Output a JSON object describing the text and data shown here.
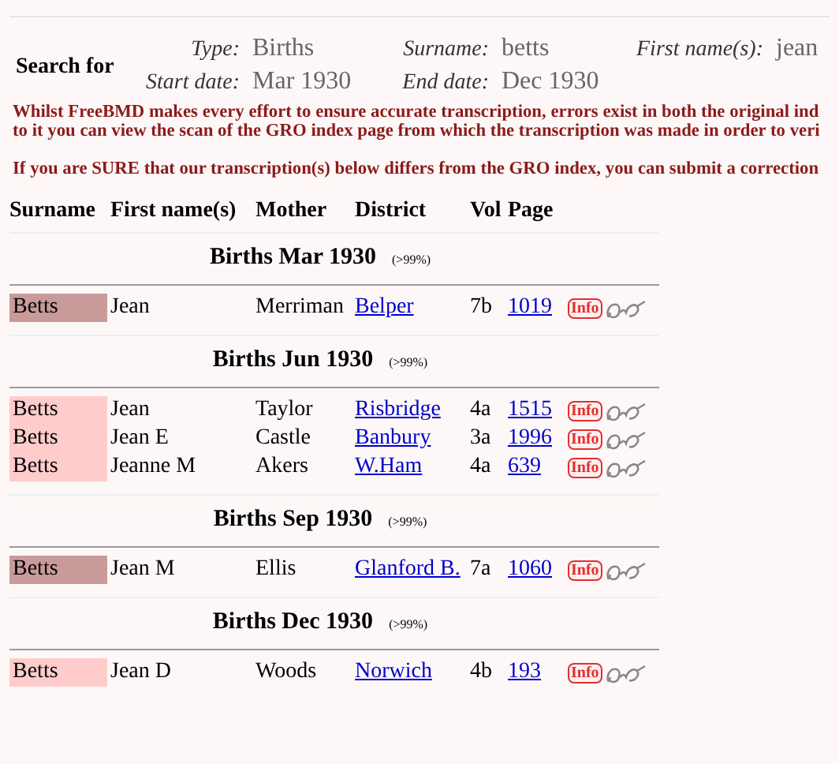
{
  "search": {
    "title": "Search for",
    "fields": [
      {
        "label": "Type:",
        "value": "Births"
      },
      {
        "label": "Surname:",
        "value": "betts"
      },
      {
        "label": "First name(s):",
        "value": "jean"
      },
      {
        "label": "Start date:",
        "value": "Mar 1930"
      },
      {
        "label": "End date:",
        "value": "Dec 1930"
      }
    ]
  },
  "notices": [
    "Whilst FreeBMD makes every effort to ensure accurate transcription, errors exist in both the original ind",
    "to it you can view the scan of the GRO index page from which the transcription was made in order to veri",
    "If you are SURE that our transcription(s) below differs from the GRO index, you can submit a correction"
  ],
  "table": {
    "columns": [
      "Surname",
      "First name(s)",
      "Mother",
      "District",
      "Vol",
      "Page"
    ],
    "sections": [
      {
        "title": "Births Mar 1930",
        "accuracy": "(>99%)",
        "rows": [
          {
            "surname": "Betts",
            "color": "#c99a9a",
            "first_names": "Jean",
            "mother": "Merriman",
            "district": "Belper",
            "vol": "7b",
            "page": "1019",
            "info": "Info"
          }
        ]
      },
      {
        "title": "Births Jun 1930",
        "accuracy": "(>99%)",
        "rows": [
          {
            "surname": "Betts",
            "color": "#ffcccc",
            "first_names": "Jean",
            "mother": "Taylor",
            "district": "Risbridge",
            "vol": "4a",
            "page": "1515",
            "info": "Info"
          },
          {
            "surname": "Betts",
            "color": "#ffcccc",
            "first_names": "Jean E",
            "mother": "Castle",
            "district": "Banbury",
            "vol": "3a",
            "page": "1996",
            "info": "Info"
          },
          {
            "surname": "Betts",
            "color": "#ffcccc",
            "first_names": "Jeanne M",
            "mother": "Akers",
            "district": "W.Ham",
            "vol": "4a",
            "page": "639",
            "info": "Info"
          }
        ]
      },
      {
        "title": "Births Sep 1930",
        "accuracy": "(>99%)",
        "rows": [
          {
            "surname": "Betts",
            "color": "#c99a9a",
            "first_names": "Jean M",
            "mother": "Ellis",
            "district": "Glanford B.",
            "vol": "7a",
            "page": "1060",
            "info": "Info"
          }
        ]
      },
      {
        "title": "Births Dec 1930",
        "accuracy": "(>99%)",
        "rows": [
          {
            "surname": "Betts",
            "color": "#ffcccc",
            "first_names": "Jean D",
            "mother": "Woods",
            "district": "Norwich",
            "vol": "4b",
            "page": "193",
            "info": "Info"
          }
        ]
      }
    ]
  }
}
